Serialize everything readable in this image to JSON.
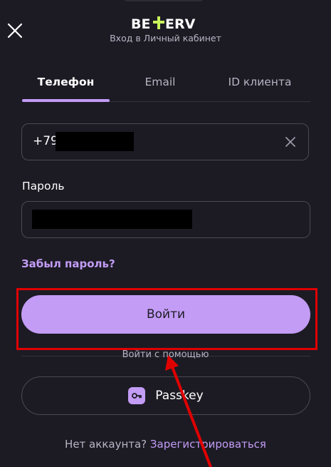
{
  "header": {
    "logo_text": "BETERV",
    "subtitle": "Вход в Личный кабинет",
    "close_icon": "close-icon"
  },
  "tabs": [
    {
      "label": "Телефон",
      "active": true
    },
    {
      "label": "Email",
      "active": false
    },
    {
      "label": "ID клиента",
      "active": false
    }
  ],
  "phone_field": {
    "value": "+79",
    "clear_icon": "close-icon"
  },
  "password_field": {
    "label": "Пароль"
  },
  "forgot_link": "Забыл пароль?",
  "login_button": "Войти",
  "divider_text": "Войти с помощью",
  "passkey_button": {
    "label": "Passkey",
    "icon": "key-icon"
  },
  "footer": {
    "prompt": "Нет аккаунта?",
    "register_link": "Зарегистрироваться"
  },
  "colors": {
    "background": "#1c1b24",
    "accent": "#c39cf5",
    "annotation": "#e00000"
  }
}
